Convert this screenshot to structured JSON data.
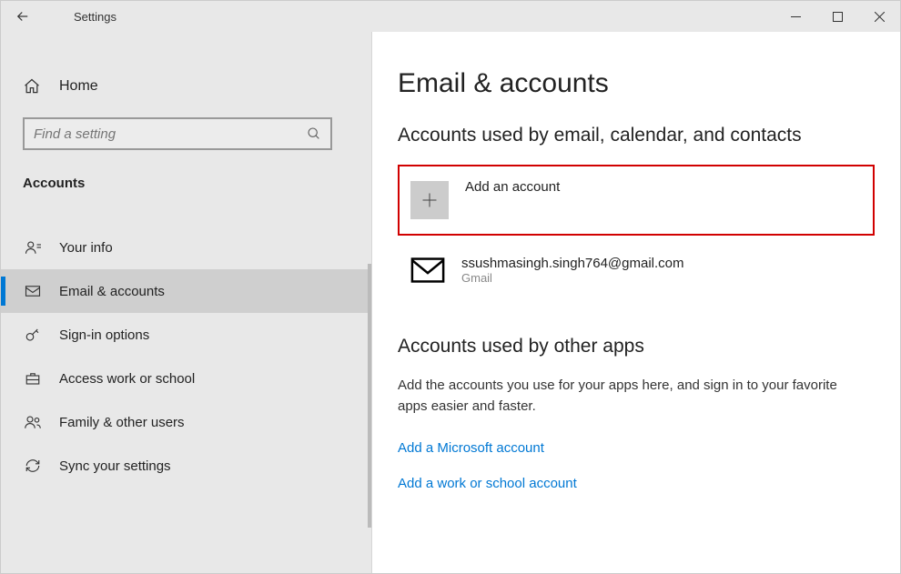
{
  "titlebar": {
    "title": "Settings"
  },
  "sidebar": {
    "home": "Home",
    "search_placeholder": "Find a setting",
    "category": "Accounts",
    "items": [
      {
        "label": "Your info"
      },
      {
        "label": "Email & accounts"
      },
      {
        "label": "Sign-in options"
      },
      {
        "label": "Access work or school"
      },
      {
        "label": "Family & other users"
      },
      {
        "label": "Sync your settings"
      }
    ]
  },
  "content": {
    "page_title": "Email & accounts",
    "section1_title": "Accounts used by email, calendar, and contacts",
    "add_account": "Add an account",
    "accounts": [
      {
        "email": "ssushmasingh.singh764@gmail.com",
        "provider": "Gmail"
      }
    ],
    "section2_title": "Accounts used by other apps",
    "section2_desc": "Add the accounts you use for your apps here, and sign in to your favorite apps easier and faster.",
    "link_ms": "Add a Microsoft account",
    "link_work": "Add a work or school account"
  }
}
